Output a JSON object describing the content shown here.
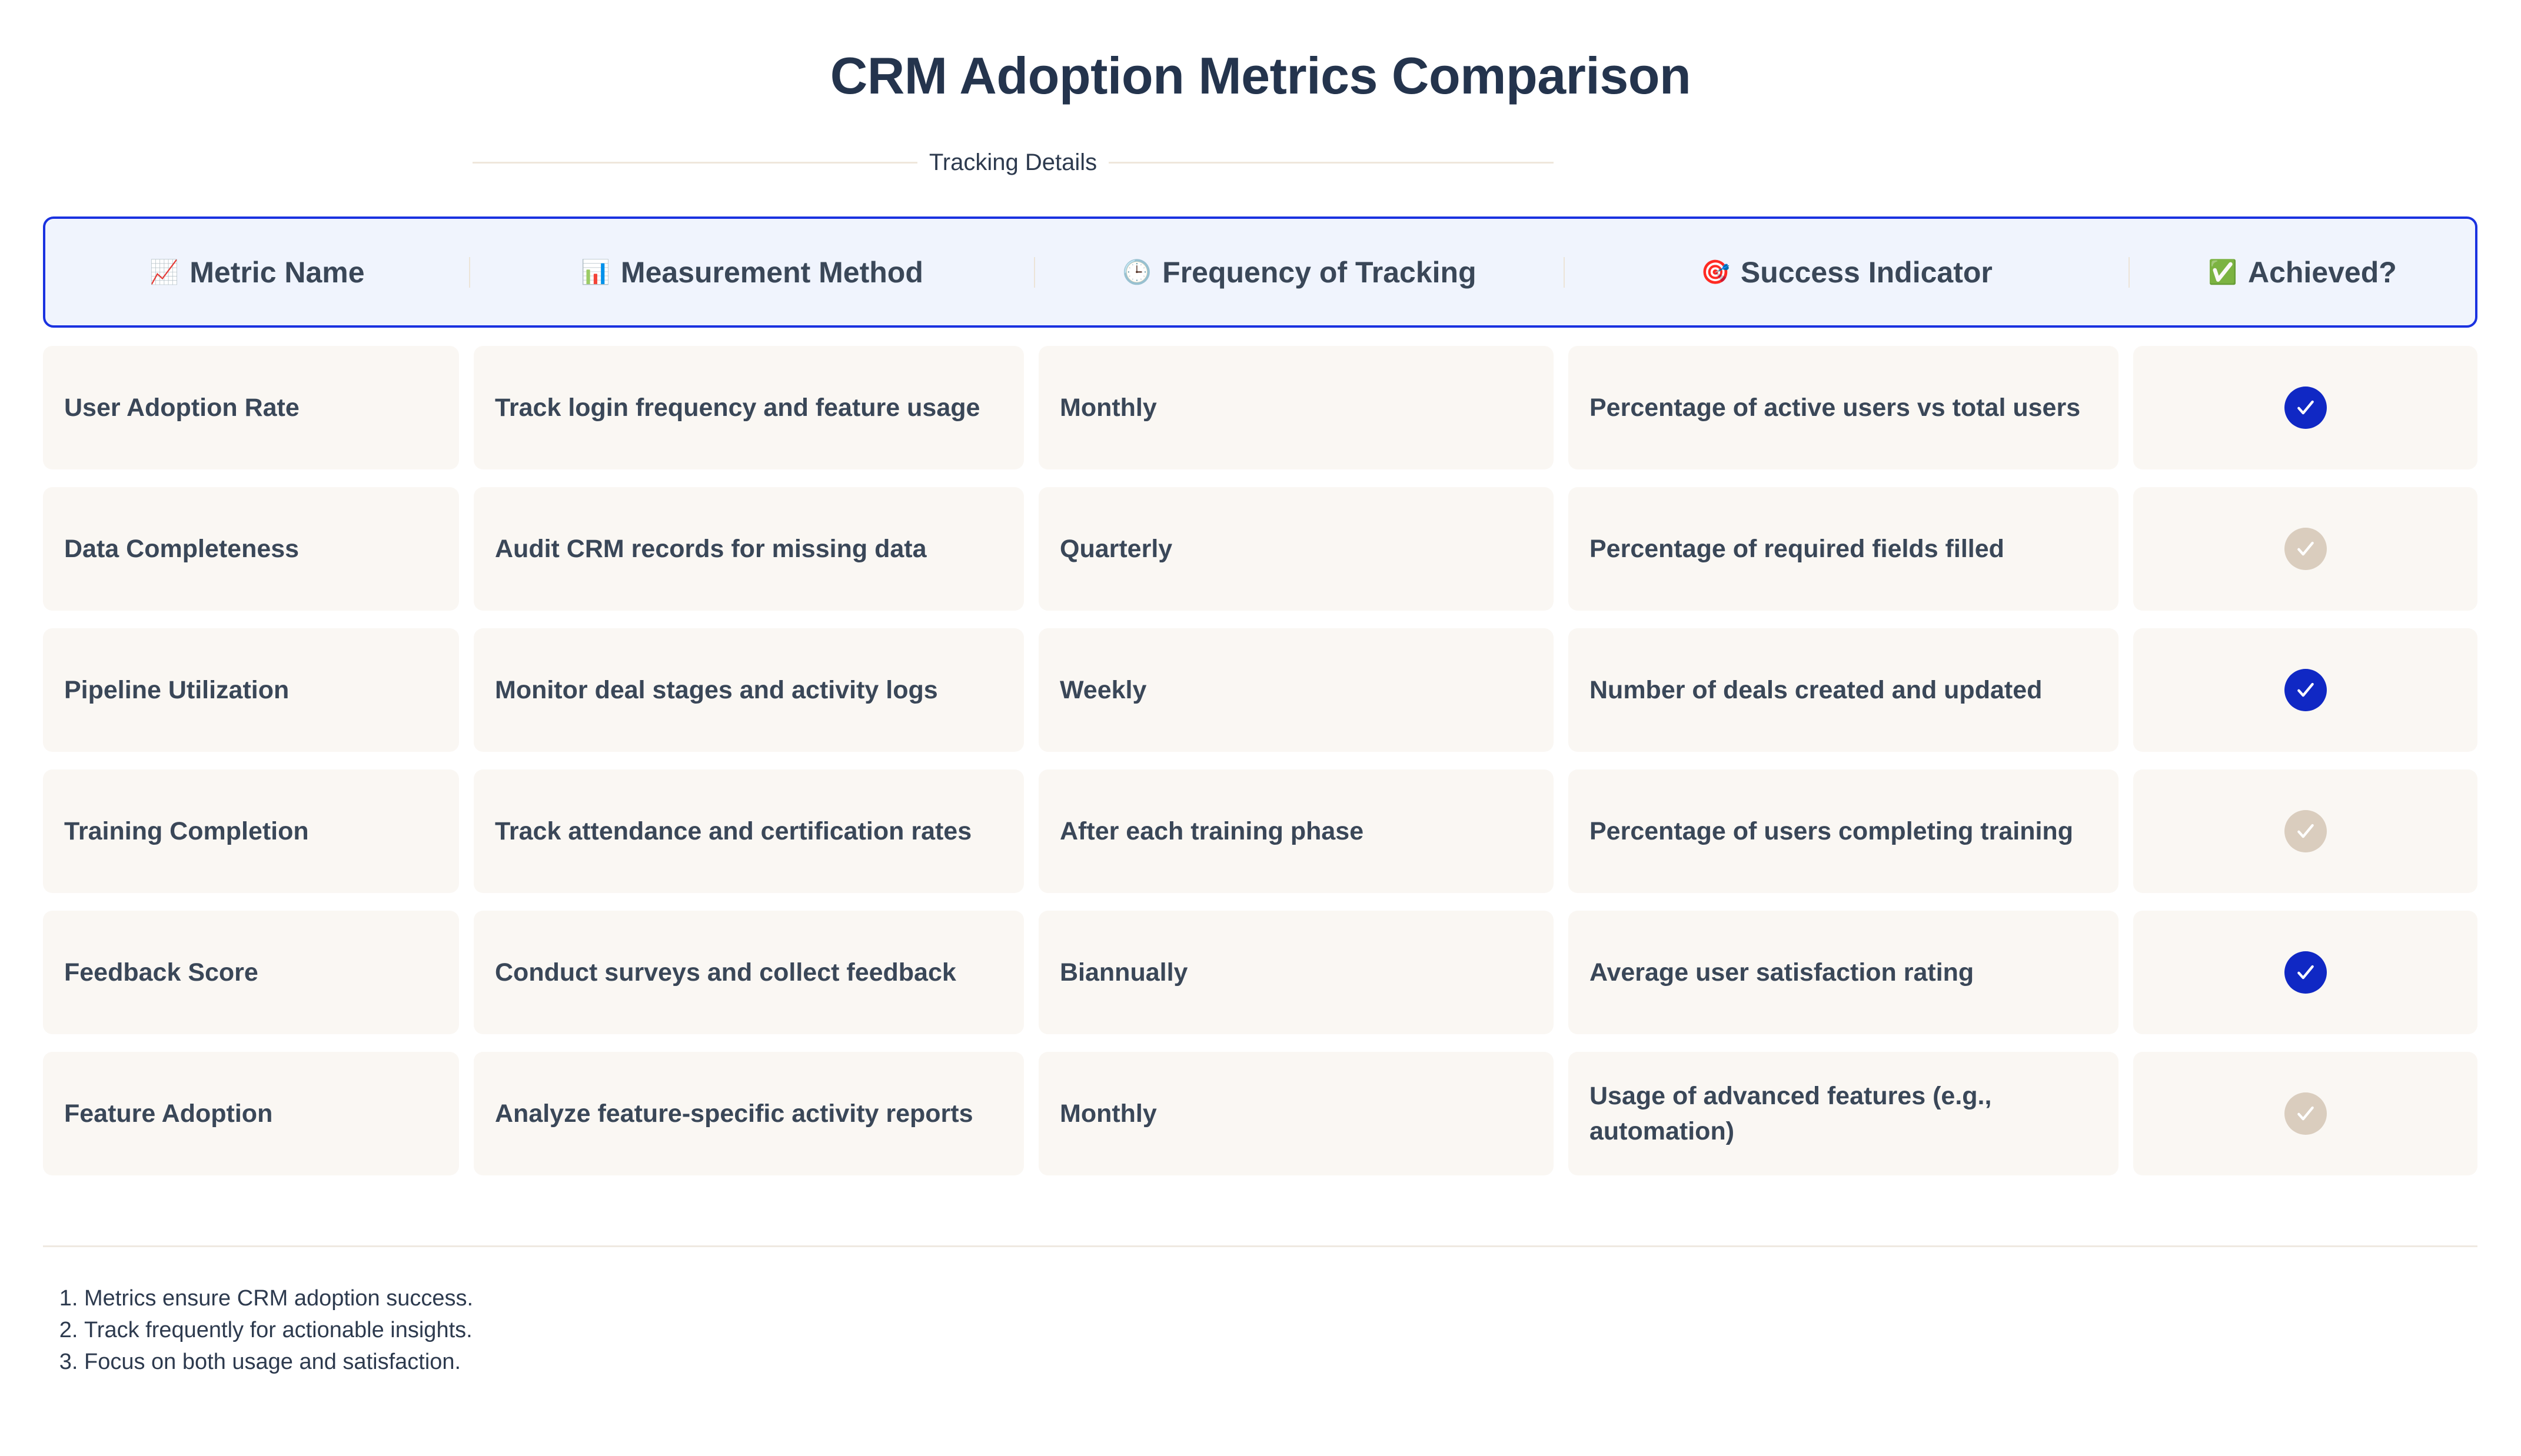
{
  "title": "CRM Adoption Metrics Comparison",
  "subtitle": "Tracking Details",
  "colors": {
    "header_border": "#1a32e0",
    "header_bg": "#f0f4fd",
    "cell_bg": "#faf7f3",
    "achieved_yes": "#1028c4",
    "achieved_no": "#dacdbe",
    "text": "#3a4758"
  },
  "columns": [
    {
      "icon": "chart-increasing-icon",
      "glyph": "📈",
      "label": "Metric Name"
    },
    {
      "icon": "bar-chart-icon",
      "glyph": "📊",
      "label": "Measurement Method"
    },
    {
      "icon": "clock-icon",
      "glyph": "🕒",
      "label": "Frequency of Tracking"
    },
    {
      "icon": "target-icon",
      "glyph": "🎯",
      "label": "Success Indicator"
    },
    {
      "icon": "check-mark-button-icon",
      "glyph": "✅",
      "label": "Achieved?"
    }
  ],
  "rows": [
    {
      "metric": "User Adoption Rate",
      "method": "Track login frequency and feature usage",
      "frequency": "Monthly",
      "indicator": "Percentage of active users vs total users",
      "achieved": true
    },
    {
      "metric": "Data Completeness",
      "method": "Audit CRM records for missing data",
      "frequency": "Quarterly",
      "indicator": "Percentage of required fields filled",
      "achieved": false
    },
    {
      "metric": "Pipeline Utilization",
      "method": "Monitor deal stages and activity logs",
      "frequency": "Weekly",
      "indicator": "Number of deals created and updated",
      "achieved": true
    },
    {
      "metric": "Training Completion",
      "method": "Track attendance and certification rates",
      "frequency": "After each training phase",
      "indicator": "Percentage of users completing training",
      "achieved": false
    },
    {
      "metric": "Feedback Score",
      "method": "Conduct surveys and collect feedback",
      "frequency": "Biannually",
      "indicator": "Average user satisfaction rating",
      "achieved": true
    },
    {
      "metric": "Feature Adoption",
      "method": "Analyze feature-specific activity reports",
      "frequency": "Monthly",
      "indicator": "Usage of advanced features (e.g., automation)",
      "achieved": false
    }
  ],
  "notes": [
    "Metrics ensure CRM adoption success.",
    "Track frequently for actionable insights.",
    "Focus on both usage and satisfaction."
  ]
}
